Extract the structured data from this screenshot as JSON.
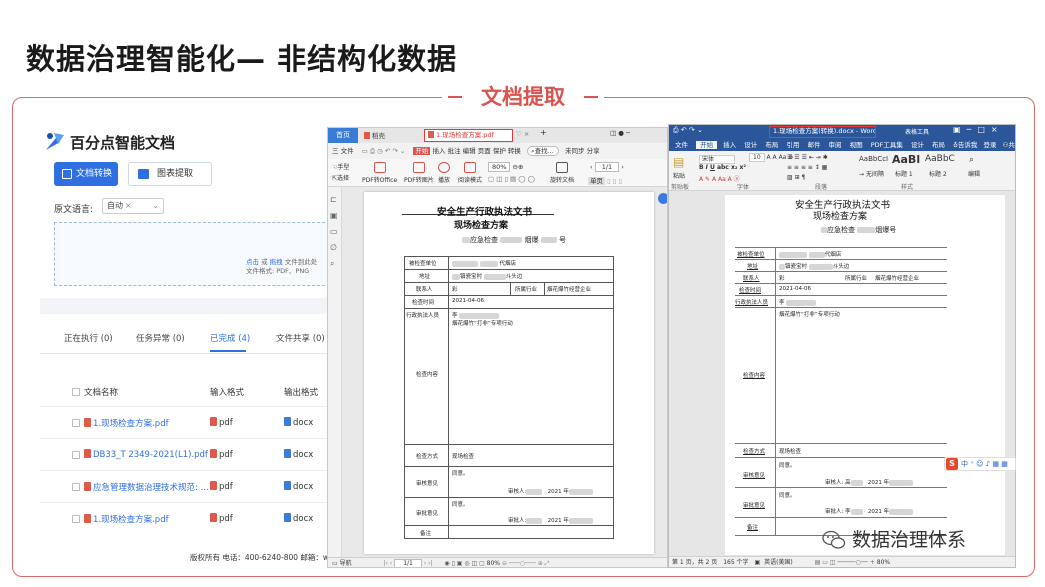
{
  "slide": {
    "title": "数据治理智能化— 非结构化数据",
    "section_label": "文档提取",
    "watermark": "数据治理体系"
  },
  "app": {
    "brand": "百分点智能文档",
    "buttons": {
      "convert": "文档转换",
      "chart_extract": "图表提取"
    },
    "language": {
      "label": "原文语言:",
      "value": "自动",
      "clear": "×"
    },
    "upload": {
      "action_click": "点击",
      "or": " 或 ",
      "action_drag": "拖拽",
      "hint_tail": " 文件到此处",
      "formats": "文件格式: PDF、PNG"
    },
    "tabs": [
      {
        "label": "正在执行 (0)"
      },
      {
        "label": "任务异常 (0)"
      },
      {
        "label": "已完成 (4)"
      },
      {
        "label": "文件共享 (0)"
      }
    ],
    "table": {
      "columns": [
        "文档名称",
        "输入格式",
        "输出格式"
      ],
      "rows": [
        {
          "name": "1.现场检查方案.pdf",
          "input": "pdf",
          "output": "docx"
        },
        {
          "name": "DB33_T 2349-2021(L1).pdf",
          "input": "pdf",
          "output": "docx"
        },
        {
          "name": "应急管理数据治理技术规范: ...",
          "input": "pdf",
          "output": "docx"
        },
        {
          "name": "1.现场检查方案.pdf",
          "input": "pdf",
          "output": "docx"
        }
      ]
    },
    "footer": "版权所有 电话：400-6240-800 邮箱：wenda"
  },
  "pdf_viewer": {
    "home_tab": "首页",
    "tab_template": "稻壳",
    "active_tab": "1.现场检查方案.pdf",
    "menu": [
      "三 文件",
      "开始",
      "插入",
      "批注",
      "编辑",
      "页面",
      "保护",
      "转换"
    ],
    "search_hint": "查找...",
    "menu_right": [
      "未同步",
      "分享"
    ],
    "ribbon": [
      "手型",
      "选择",
      "PDF转Office",
      "PDF转图片",
      "播放",
      "阅读模式",
      "旋转文档",
      "单页"
    ],
    "zoom": "80%",
    "page_indicator": "1/1",
    "status": {
      "nav": "导航",
      "page": "1/1",
      "zoom": "80%"
    }
  },
  "document": {
    "title1": "安全生产行政执法文书",
    "title2": "现场检查方案",
    "doc_no_prefix": "应急检查",
    "doc_no_mid": "烟爆",
    "doc_no_suffix": "号",
    "fields": {
      "unit": "被检查单位",
      "unit_val": "代烟店",
      "address": "地址",
      "address_val": "镇瓷宝村",
      "address_tail": "斗头边",
      "contact": "联系人",
      "contact_val": "彩",
      "industry": "所属行业",
      "industry_val": "烟花爆竹经营企业",
      "time": "检查时间",
      "time_val": "2021-04-06",
      "staff": "行政执法人员",
      "staff_val": "李",
      "content": "检查内容",
      "content_val": "烟花爆竹“打非”专项行动",
      "method": "检查方式",
      "method_val": "现场检查",
      "review": "审核意见",
      "approve": "审批意见",
      "remark": "备注",
      "agree": "同意。",
      "reviewer": "审核人:",
      "approver": "审批人:",
      "year": "2021 年"
    }
  },
  "word": {
    "title": "1.现场检查方案(转换).docx - Word",
    "tool_tab": "表格工具",
    "tabs": [
      "文件",
      "开始",
      "插入",
      "设计",
      "布局",
      "引用",
      "邮件",
      "审阅",
      "视图",
      "PDF工具集",
      "设计",
      "布局"
    ],
    "tell_me": "告诉我",
    "login": "登录",
    "share": "共享",
    "clipboard": "粘贴",
    "font_name": "宋体",
    "font_size": "10",
    "styles": [
      {
        "sample": "AaBbCcI",
        "name": "→ 无间隔"
      },
      {
        "sample": "AaBl",
        "name": "标题 1"
      },
      {
        "sample": "AaBbC",
        "name": "标题 2"
      }
    ],
    "group_labels": [
      "剪贴板",
      "字体",
      "段落",
      "样式"
    ],
    "edit": "编辑",
    "status": {
      "page": "第 1 页，共 2 页",
      "words": "165 个字",
      "lang": "英语(美国)",
      "zoom": "80%"
    },
    "extra_fields": {
      "industry_val": "烟花爆竹经营企业",
      "reviewer_name": "高",
      "approver_name": "李"
    }
  },
  "ime": {
    "label": "中"
  }
}
